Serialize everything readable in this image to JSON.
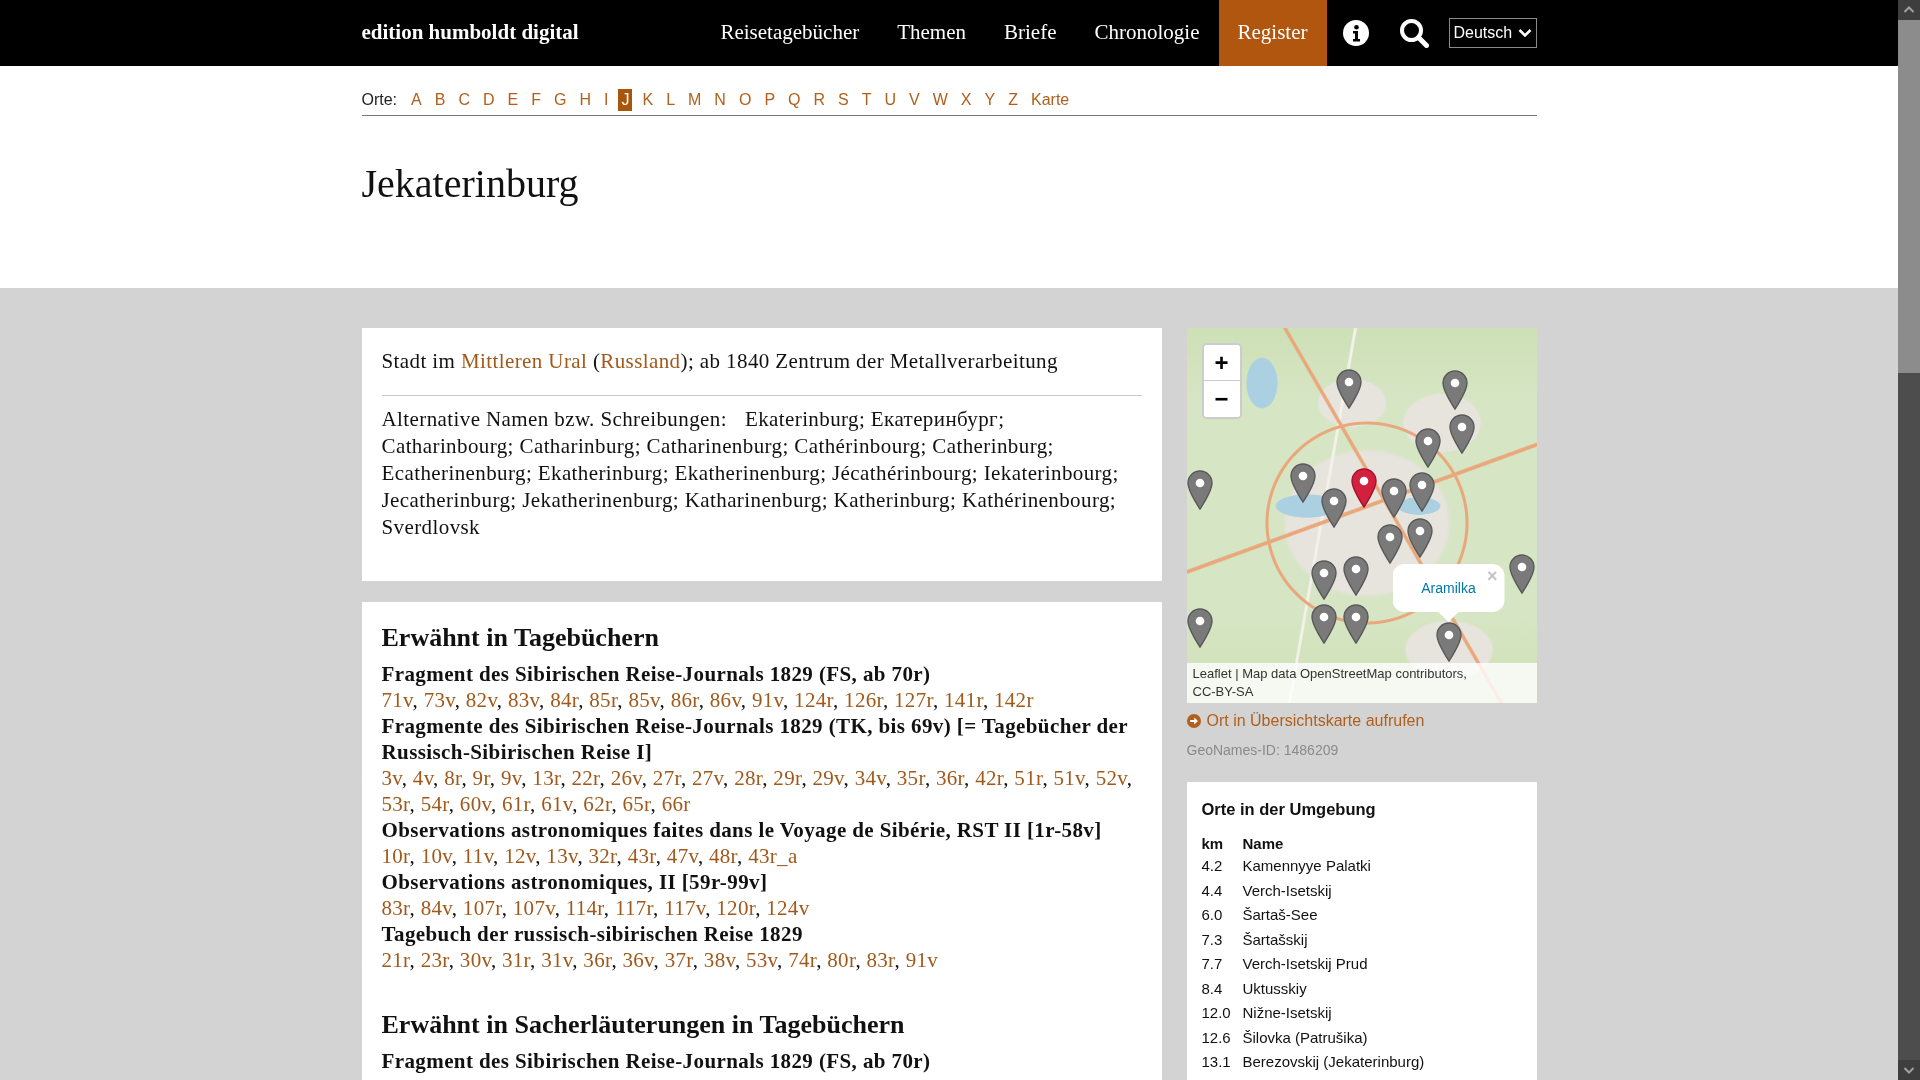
{
  "header": {
    "brand": "edition humboldt digital",
    "nav": [
      {
        "label": "Reisetagebücher",
        "selected": false
      },
      {
        "label": "Themen",
        "selected": false
      },
      {
        "label": "Briefe",
        "selected": false
      },
      {
        "label": "Chronologie",
        "selected": false
      },
      {
        "label": "Register",
        "selected": true
      }
    ],
    "language": "Deutsch"
  },
  "index_bar": {
    "label": "Orte:",
    "letters": [
      {
        "label": "A",
        "selected": false
      },
      {
        "label": "B",
        "selected": false
      },
      {
        "label": "C",
        "selected": false
      },
      {
        "label": "D",
        "selected": false
      },
      {
        "label": "E",
        "selected": false
      },
      {
        "label": "F",
        "selected": false
      },
      {
        "label": "G",
        "selected": false
      },
      {
        "label": "H",
        "selected": false
      },
      {
        "label": "I",
        "selected": false
      },
      {
        "label": "J",
        "selected": true
      },
      {
        "label": "K",
        "selected": false
      },
      {
        "label": "L",
        "selected": false
      },
      {
        "label": "M",
        "selected": false
      },
      {
        "label": "N",
        "selected": false
      },
      {
        "label": "O",
        "selected": false
      },
      {
        "label": "P",
        "selected": false
      },
      {
        "label": "Q",
        "selected": false
      },
      {
        "label": "R",
        "selected": false
      },
      {
        "label": "S",
        "selected": false
      },
      {
        "label": "T",
        "selected": false
      },
      {
        "label": "U",
        "selected": false
      },
      {
        "label": "V",
        "selected": false
      },
      {
        "label": "W",
        "selected": false
      },
      {
        "label": "X",
        "selected": false
      },
      {
        "label": "Y",
        "selected": false
      },
      {
        "label": "Z",
        "selected": false
      },
      {
        "label": "Karte",
        "selected": false
      }
    ]
  },
  "title": "Jekaterinburg",
  "description": [
    {
      "kind": "text",
      "text": "Stadt im "
    },
    {
      "kind": "link",
      "text": "Mittleren Ural"
    },
    {
      "kind": "text",
      "text": " ("
    },
    {
      "kind": "link",
      "text": "Russland"
    },
    {
      "kind": "text",
      "text": "); ab 1840 Zentrum der Metallverarbeitung"
    }
  ],
  "alternative_names": {
    "label": "Alternative Namen bzw. Schreibungen:",
    "separator": "; ",
    "names": [
      "Ekaterinburg",
      "Екатеринбург",
      "Catharinbourg",
      "Catharinburg",
      "Catharinenburg",
      "Cathérinbourg",
      "Catherinburg",
      "Ecatherinenburg",
      "Ekatherinburg",
      "Ekatherinenburg",
      "Jécathérinbourg",
      "Iekaterinbourg",
      "Jecatherinburg",
      "Jekatherinenburg",
      "Katharinenburg",
      "Katherinburg",
      "Kathérinenbourg",
      "Sverdlovsk"
    ]
  },
  "mentions": {
    "separator": ", ",
    "sections": [
      {
        "heading": "Erwähnt in Tagebüchern",
        "works": [
          {
            "title": "Fragment des Sibirischen Reise-Journals 1829 (FS, ab 70r)",
            "pages": [
              "71v",
              "73v",
              "82v",
              "83v",
              "84r",
              "85r",
              "85v",
              "86r",
              "86v",
              "91v",
              "124r",
              "126r",
              "127r",
              "141r",
              "142r"
            ]
          },
          {
            "title": "Fragmente des Sibirischen Reise-Journals 1829 (TK, bis 69v) [= Tagebücher der Russisch-Sibirischen Reise I]",
            "pages": [
              "3v",
              "4v",
              "8r",
              "9r",
              "9v",
              "13r",
              "22r",
              "26v",
              "27r",
              "27v",
              "28r",
              "29r",
              "29v",
              "34v",
              "35r",
              "36r",
              "42r",
              "51r",
              "51v",
              "52v",
              "53r",
              "54r",
              "60v",
              "61r",
              "61v",
              "62r",
              "65r",
              "66r"
            ]
          },
          {
            "title": "Observations astronomiques faites dans le Voyage de Sibérie, RST II [1r-58v]",
            "pages": [
              "10r",
              "10v",
              "11v",
              "12v",
              "13v",
              "32r",
              "43r",
              "47v",
              "48r",
              "43r_a"
            ]
          },
          {
            "title": "Observations astronomiques, II [59r-99v]",
            "pages": [
              "83r",
              "84v",
              "107r",
              "107v",
              "114r",
              "117r",
              "117v",
              "120r",
              "124v"
            ]
          },
          {
            "title": "Tagebuch der russisch-sibirischen Reise 1829",
            "pages": [
              "21r",
              "23r",
              "30v",
              "31r",
              "31v",
              "36r",
              "36v",
              "37r",
              "38v",
              "53v",
              "74r",
              "80r",
              "83r",
              "91v"
            ]
          }
        ]
      },
      {
        "heading": "Erwähnt in Sacherläuterungen in Tagebüchern",
        "works": [
          {
            "title": "Fragment des Sibirischen Reise-Journals 1829 (FS, ab 70r)"
          }
        ]
      }
    ]
  },
  "map": {
    "zoom_controls": [
      "+",
      "−"
    ],
    "markers": [
      {
        "selected": false
      },
      {
        "selected": false
      },
      {
        "selected": false
      },
      {
        "selected": false
      },
      {
        "selected": false
      },
      {
        "selected": false
      },
      {
        "selected": true
      },
      {
        "selected": false
      },
      {
        "selected": false
      },
      {
        "selected": false
      },
      {
        "selected": false
      },
      {
        "selected": false
      },
      {
        "selected": false
      },
      {
        "selected": false
      },
      {
        "selected": false
      },
      {
        "selected": false
      },
      {
        "selected": false
      },
      {
        "selected": false
      },
      {
        "selected": false
      }
    ],
    "popup": {
      "link": "Aramilka",
      "close": "×"
    },
    "attribution": [
      {
        "kind": "link",
        "text": "Leaflet"
      },
      {
        "kind": "text",
        "text": "| Map data"
      },
      {
        "kind": "link",
        "text": "OpenStreetMap"
      },
      {
        "kind": "text",
        "text": "contributors,"
      },
      {
        "kind": "link",
        "text": "CC-BY-SA"
      }
    ]
  },
  "map_link": "Ort in Übersichtskarte aufrufen",
  "geonames": "GeoNames-ID: 1486209",
  "nearby": {
    "title": "Orte in der Umgebung",
    "columns": [
      "km",
      "Name"
    ],
    "rows": [
      {
        "km": "4.2",
        "name": "Kamennyye Palatki"
      },
      {
        "km": "4.4",
        "name": "Verch-Isetskij"
      },
      {
        "km": "6.0",
        "name": "Šartaš-See"
      },
      {
        "km": "7.3",
        "name": "Šartašskij"
      },
      {
        "km": "7.7",
        "name": "Verch-Isetskij Prud"
      },
      {
        "km": "8.4",
        "name": "Uktusskiy"
      },
      {
        "km": "12.0",
        "name": "Nižne-Isetskij"
      },
      {
        "km": "12.6",
        "name": "Šilovka (Patrušika)"
      },
      {
        "km": "13.1",
        "name": "Berezovskij (Jekaterinburg)"
      }
    ]
  }
}
